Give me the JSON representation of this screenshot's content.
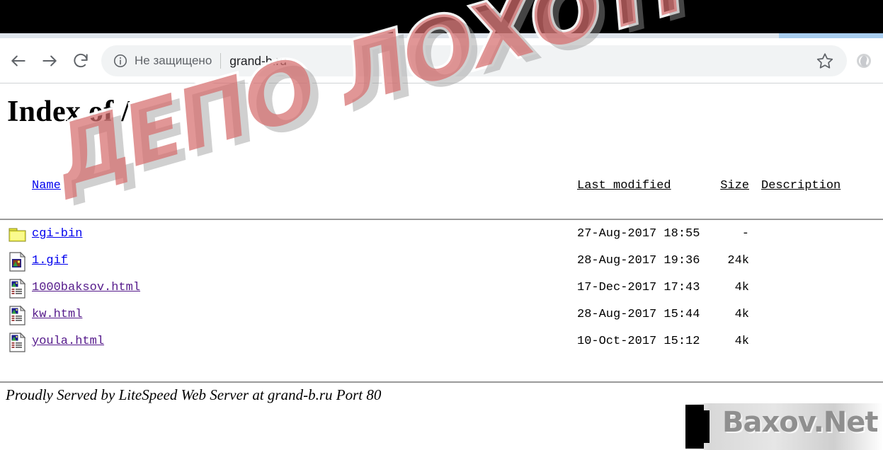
{
  "browser": {
    "back_icon": "arrow-left-icon",
    "forward_icon": "arrow-right-icon",
    "reload_icon": "reload-icon",
    "security_icon": "info-circle-icon",
    "security_label": "Не защищено",
    "url": "grand-b.ru",
    "bookmark_icon": "star-icon",
    "profile_icon": "profile-avatar-icon"
  },
  "page": {
    "title": "Index of /",
    "columns": {
      "name": "Name",
      "last_modified": "Last modified",
      "size": "Size",
      "description": "Description"
    },
    "rows": [
      {
        "icon": "folder-icon",
        "name": "cgi-bin",
        "visited": false,
        "last_modified": "27-Aug-2017 18:55",
        "size": "-",
        "description": ""
      },
      {
        "icon": "image-file-icon",
        "name": "1.gif",
        "visited": false,
        "last_modified": "28-Aug-2017 19:36",
        "size": "24k",
        "description": ""
      },
      {
        "icon": "html-file-icon",
        "name": "1000baksov.html",
        "visited": true,
        "last_modified": "17-Dec-2017 17:43",
        "size": "4k",
        "description": ""
      },
      {
        "icon": "html-file-icon",
        "name": "kw.html",
        "visited": true,
        "last_modified": "28-Aug-2017 15:44",
        "size": "4k",
        "description": ""
      },
      {
        "icon": "html-file-icon",
        "name": "youla.html",
        "visited": true,
        "last_modified": "10-Oct-2017 15:12",
        "size": "4k",
        "description": ""
      }
    ],
    "footer": "Proudly Served by LiteSpeed Web Server at grand-b.ru Port 80"
  },
  "overlay": {
    "watermark_text": "ДЕПО ЛОХОТРОНОВ",
    "watermark_color": "#d66e6e",
    "brand_text": "Baxov.Net",
    "brand_color": "#8f8f8f"
  }
}
